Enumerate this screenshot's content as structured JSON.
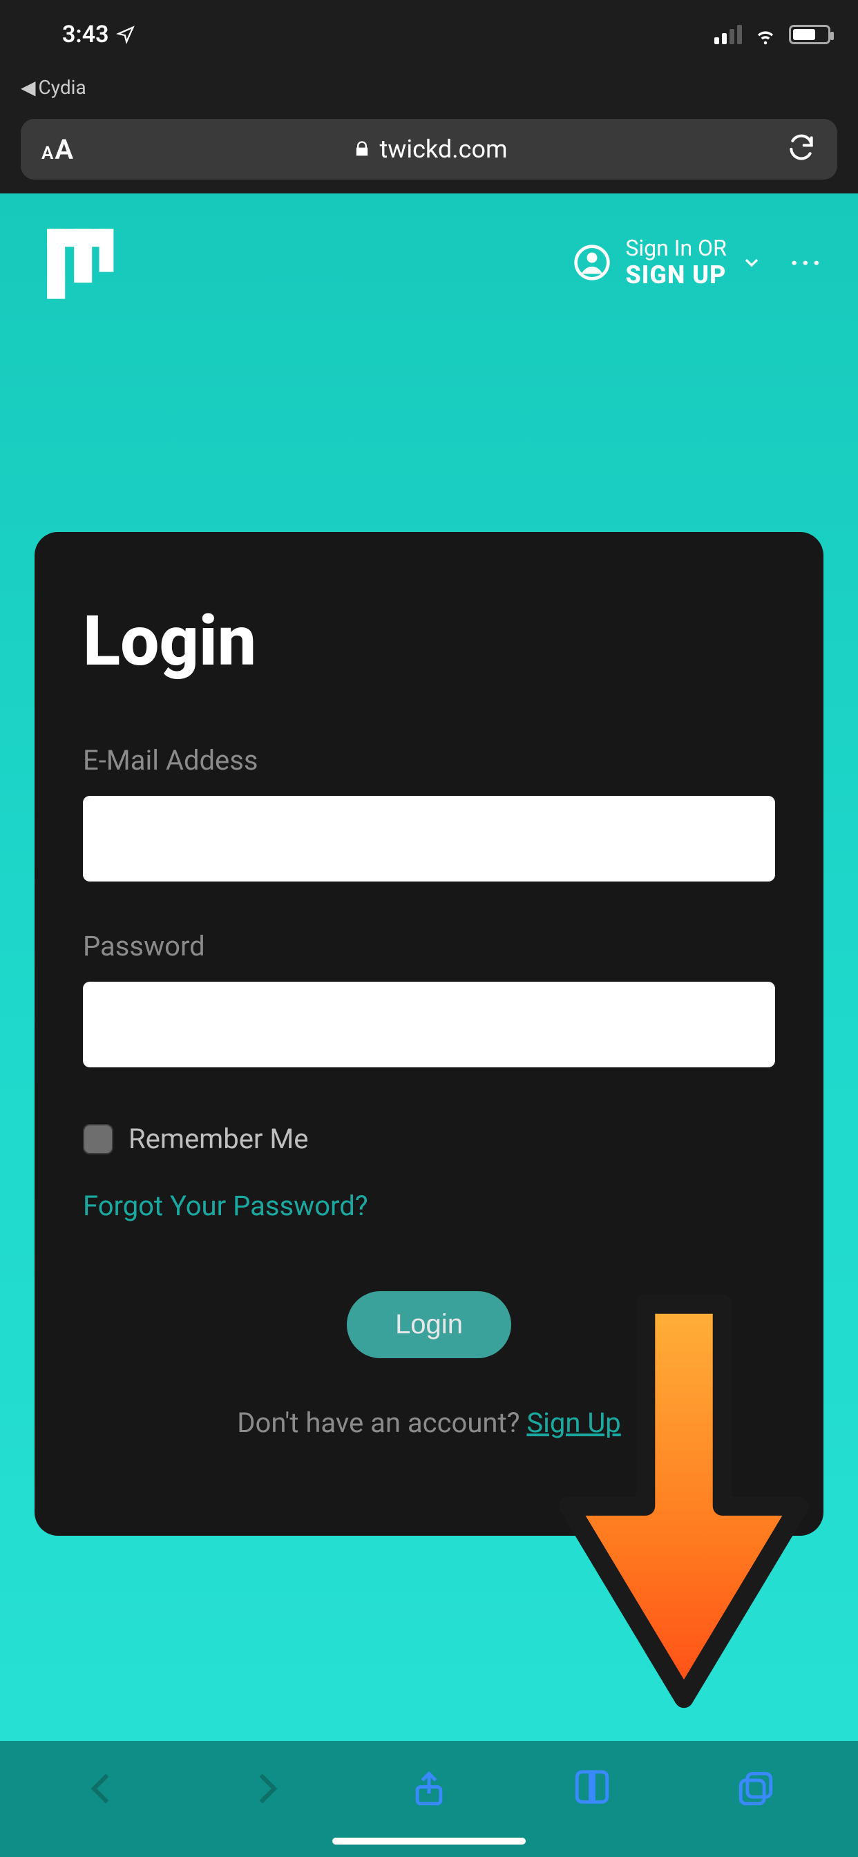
{
  "status": {
    "time": "3:43",
    "back_app": "Cydia"
  },
  "browser": {
    "url_display": "twickd.com"
  },
  "header": {
    "signin_line1": "Sign In OR",
    "signin_line2": "SIGN UP"
  },
  "login": {
    "title": "Login",
    "email_label": "E-Mail Addess",
    "email_value": "",
    "password_label": "Password",
    "password_value": "",
    "remember_label": "Remember Me",
    "forgot_label": "Forgot Your Password?",
    "login_button": "Login",
    "no_account_text": "Don't have an account? ",
    "signup_link": "Sign Up"
  },
  "colors": {
    "accent": "#1aa9a0",
    "gradient_top": "#17c9bb",
    "gradient_bottom": "#27e0d4",
    "card_bg": "#171717"
  }
}
